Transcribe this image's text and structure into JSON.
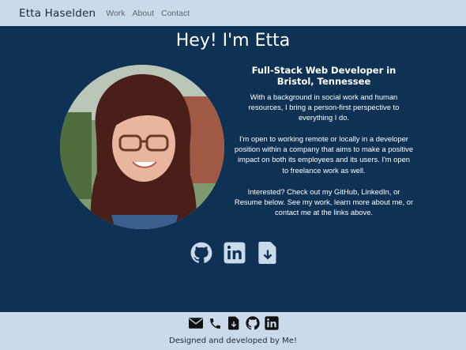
{
  "nav": {
    "brand": "Etta Haselden",
    "links": [
      "Work",
      "About",
      "Contact"
    ]
  },
  "hero": {
    "title": "Hey! I'm Etta",
    "photo_alt": "Portrait of Etta",
    "subtitle": "Full-Stack Web Developer in Bristol, Tennessee",
    "bio": [
      "With a background in social work and human resources, I bring a person-first perspective to everything I do.",
      "I'm open to working remote or locally in a developer position within a company that aims to make a positive impact on both its employees and its users. I'm open to freelance work as well.",
      "Interested? Check out my GitHub, LinkedIn, or Resume below. See my work, learn more about me, or contact me at the links above."
    ]
  },
  "social_icons": [
    "github-icon",
    "linkedin-icon",
    "resume-download-icon"
  ],
  "footer": {
    "icons": [
      "email-icon",
      "phone-icon",
      "resume-download-icon",
      "github-icon",
      "linkedin-icon"
    ],
    "text": "Designed and developed by Me!"
  },
  "colors": {
    "nav_bg": "#c9dbeb",
    "page_bg": "#0e3253",
    "text_light": "#ffffff",
    "text_dark": "#1b2b3c",
    "icon_light": "#c9dbeb"
  }
}
